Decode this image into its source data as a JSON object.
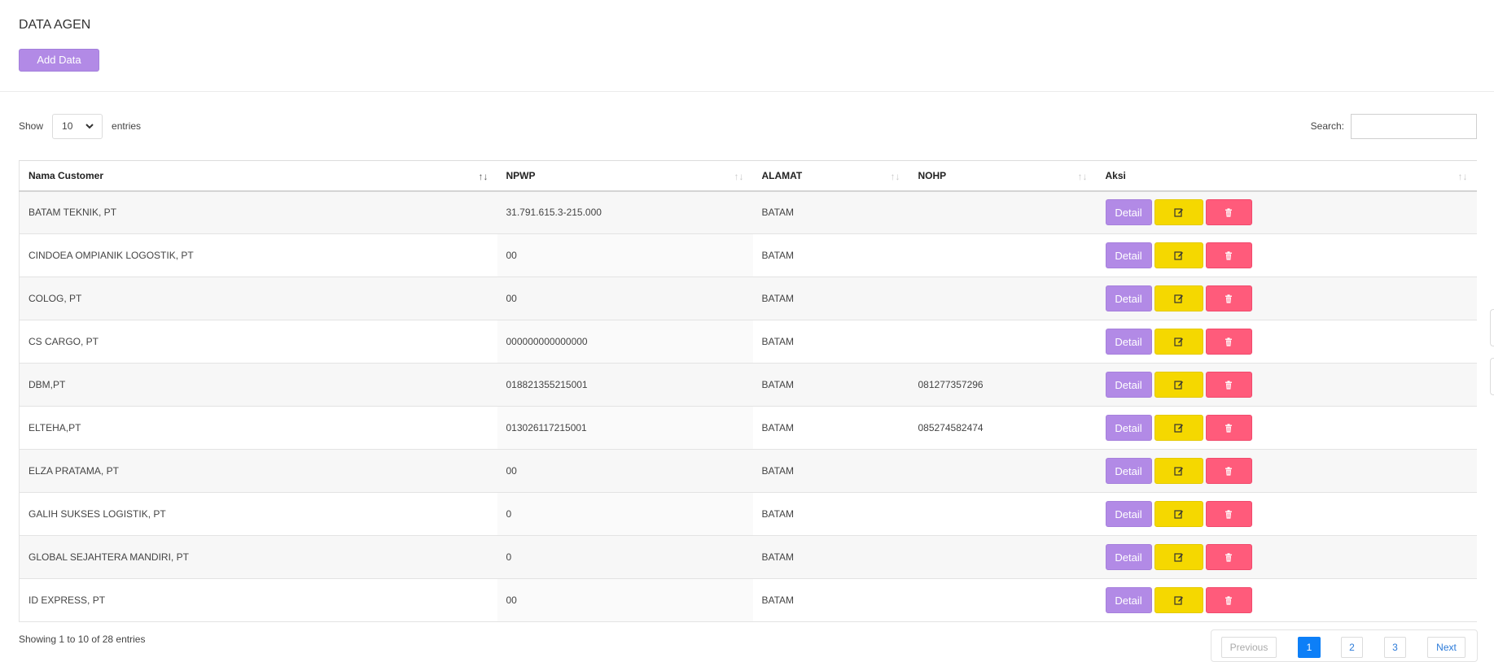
{
  "page": {
    "title": "DATA AGEN",
    "add_label": "Add Data"
  },
  "length": {
    "show_label": "Show",
    "value": "10",
    "entries_label": "entries"
  },
  "search": {
    "label": "Search:",
    "value": ""
  },
  "table": {
    "columns": [
      "Nama Customer",
      "NPWP",
      "ALAMAT",
      "NOHP",
      "Aksi"
    ],
    "rows": [
      {
        "nama": "BATAM TEKNIK, PT",
        "npwp": "31.791.615.3-215.000",
        "alamat": "BATAM",
        "nohp": ""
      },
      {
        "nama": "CINDOEA OMPIANIK LOGOSTIK, PT",
        "npwp": "00",
        "alamat": "BATAM",
        "nohp": ""
      },
      {
        "nama": "COLOG, PT",
        "npwp": "00",
        "alamat": "BATAM",
        "nohp": ""
      },
      {
        "nama": "CS CARGO, PT",
        "npwp": "000000000000000",
        "alamat": "BATAM",
        "nohp": ""
      },
      {
        "nama": "DBM,PT",
        "npwp": "018821355215001",
        "alamat": "BATAM",
        "nohp": "081277357296"
      },
      {
        "nama": "ELTEHA,PT",
        "npwp": "013026117215001",
        "alamat": "BATAM",
        "nohp": "085274582474"
      },
      {
        "nama": "ELZA PRATAMA, PT",
        "npwp": "00",
        "alamat": "BATAM",
        "nohp": ""
      },
      {
        "nama": "GALIH SUKSES LOGISTIK, PT",
        "npwp": "0",
        "alamat": "BATAM",
        "nohp": ""
      },
      {
        "nama": "GLOBAL SEJAHTERA MANDIRI, PT",
        "npwp": "0",
        "alamat": "BATAM",
        "nohp": ""
      },
      {
        "nama": "ID EXPRESS, PT",
        "npwp": "00",
        "alamat": "BATAM",
        "nohp": ""
      }
    ],
    "detail_label": "Detail"
  },
  "info": "Showing 1 to 10 of 28 entries",
  "pagination": {
    "previous": "Previous",
    "pages": [
      "1",
      "2",
      "3"
    ],
    "active": "1",
    "next": "Next"
  },
  "colors": {
    "detail": "#b28ae6",
    "edit": "#f5d800",
    "delete": "#ff5b7b",
    "active_page": "#0d7ff7"
  },
  "icons": {
    "edit": "edit-icon",
    "delete": "trash-icon",
    "sort": "sort-icon",
    "select": "chevron-down-icon"
  }
}
